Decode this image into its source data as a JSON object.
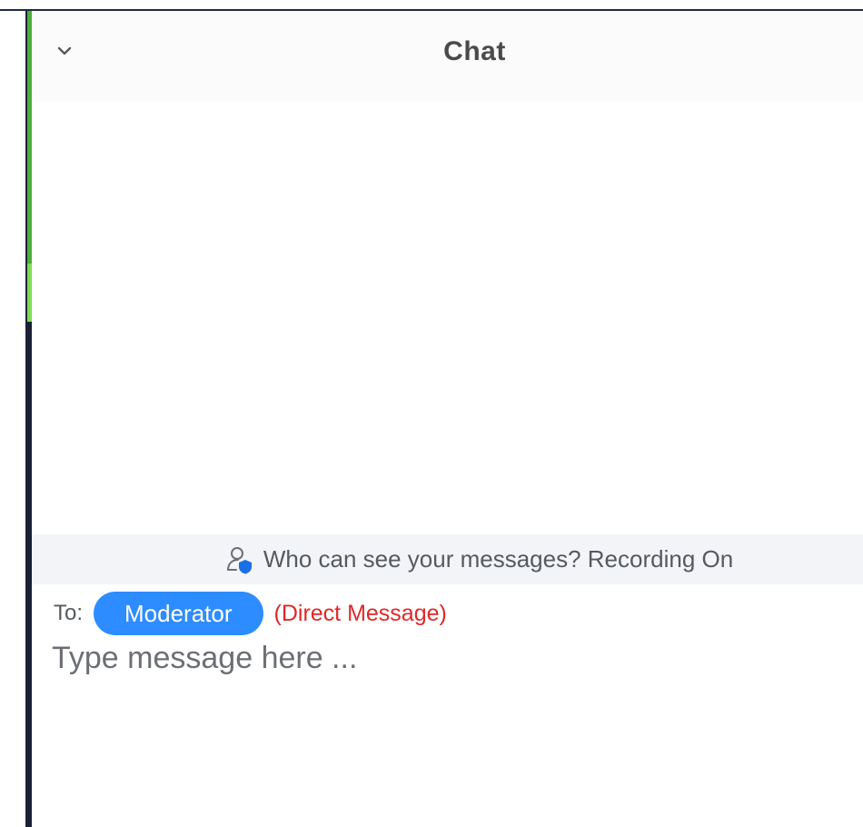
{
  "chat": {
    "title": "Chat",
    "collapse_icon": "chevron-down-icon"
  },
  "privacy": {
    "icon": "user-shield-icon",
    "text": "Who can see your messages? Recording On"
  },
  "compose": {
    "to_label": "To:",
    "recipient": "Moderator",
    "message_type": "(Direct Message)",
    "placeholder": "Type message here ...",
    "value": ""
  },
  "colors": {
    "accent": "#2d8cff",
    "direct_message": "#e02828",
    "active_speaker": "#4caf3a"
  }
}
